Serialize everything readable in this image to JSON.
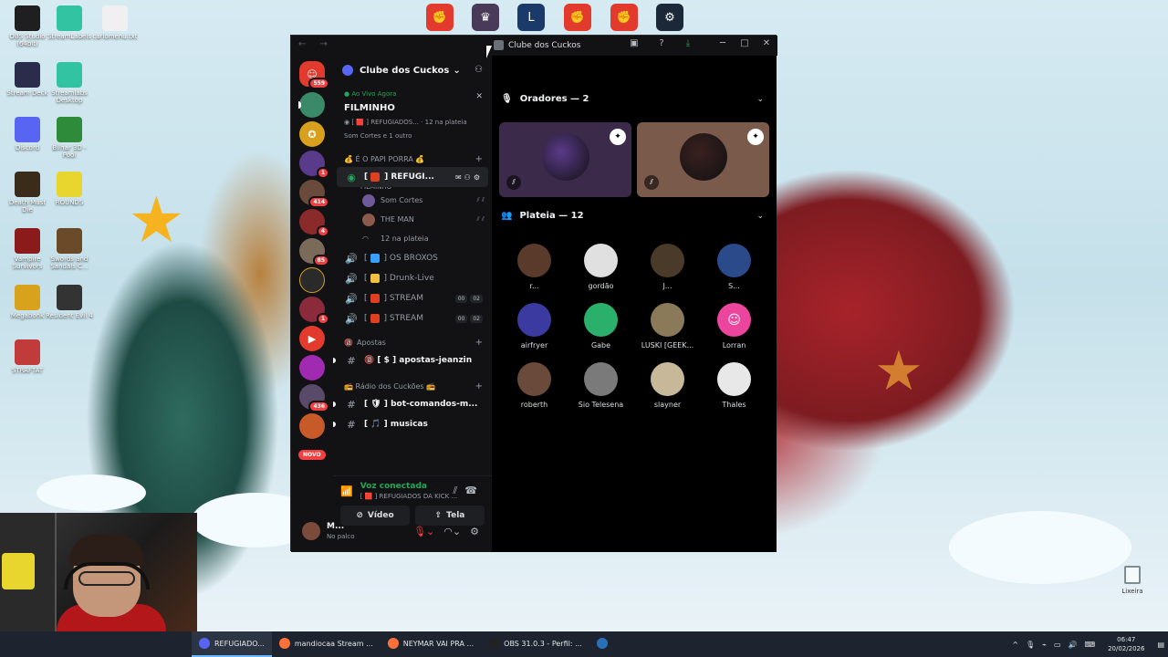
{
  "desktop": {
    "icons": [
      {
        "label": "OBS Studio (64bit)",
        "icon": "obs-icon",
        "color": "#1f1f1f"
      },
      {
        "label": "StreamLabels",
        "icon": "streamlabels-icon",
        "color": "#31c3a2"
      },
      {
        "label": "carlomenu.txt",
        "icon": "text-file-icon",
        "color": "#f0f0f0"
      },
      {
        "label": "Stream Deck",
        "icon": "stream-deck-icon",
        "color": "#2b2b4b"
      },
      {
        "label": "Streamlabs Desktop",
        "icon": "streamlabs-icon",
        "color": "#31c3a2"
      },
      {
        "label": "Discord",
        "icon": "discord-icon",
        "color": "#5865f2"
      },
      {
        "label": "Bilhar 3D - Pool",
        "icon": "pool-icon",
        "color": "#2d8b3a"
      },
      {
        "label": "Death Must Die",
        "icon": "death-must-die-icon",
        "color": "#3b2b1b"
      },
      {
        "label": "ROUNDS",
        "icon": "rounds-icon",
        "color": "#e8d52e"
      },
      {
        "label": "Vampire Survivors",
        "icon": "vampire-survivors-icon",
        "color": "#8b1a1a"
      },
      {
        "label": "Swords and Sandals C...",
        "icon": "swords-sandals-icon",
        "color": "#6b4a2a"
      },
      {
        "label": "Megabonk",
        "icon": "megabonk-icon",
        "color": "#d9a21c"
      },
      {
        "label": "Resident Evil 4",
        "icon": "resident-evil-icon",
        "color": "#333333"
      },
      {
        "label": "STRAFTAT",
        "icon": "straftat-icon",
        "color": "#c23b3b"
      }
    ],
    "recycle_bin": "Lixeira"
  },
  "webcam": {
    "label": "webcam overlay"
  },
  "discord": {
    "window_title": "Clube dos Cuckos",
    "nav_glyphs": "← →",
    "server_name": "Clube dos Cuckos",
    "guild_badges": [
      "559",
      "1",
      "414",
      "4",
      "85",
      "1",
      "436"
    ],
    "guild_new": "NOVO",
    "live": {
      "tag": "Ao Vivo Agora",
      "title": "FILMINHO",
      "channel_line": "[ 🟥 ] REFUGIADOS...",
      "audience_line": "12 na plateia",
      "members_line": "Som Cortes e 1 outro"
    },
    "categories": {
      "papi": "💰 É O PAPI PORRA 💰",
      "apostas": "Apostas",
      "radio": "📻 Rádio dos Cuckões 📻"
    },
    "stage_channel": {
      "name": "REFUGI...",
      "sub": "FILMINHO"
    },
    "stage_members": [
      {
        "name": "Som Cortes",
        "color": "#6e5a9a"
      },
      {
        "name": "THE MAN",
        "color": "#8a5a4a"
      }
    ],
    "stage_audience": "12 na plateia",
    "voice_channels": [
      {
        "name": "OS BROXOS",
        "emoji_color": "#3aa0ff",
        "tags": []
      },
      {
        "name": "Drunk-Live",
        "emoji_color": "#f0c040",
        "tags": []
      },
      {
        "name": "STREAM",
        "emoji_color": "#e04020",
        "tags": [
          "00",
          "02"
        ]
      },
      {
        "name": "STREAM",
        "emoji_color": "#e04020",
        "tags": [
          "00",
          "02"
        ]
      }
    ],
    "text_channels": [
      {
        "name": "apostas-jeanzin",
        "prefix": "🔞 [ $ ]"
      },
      {
        "name": "bot-comandos-m...",
        "prefix": "[ 🛡 ]"
      },
      {
        "name": "musicas",
        "prefix": "[ 🎵 ]"
      }
    ],
    "voice_panel": {
      "status": "Voz conectada",
      "channel": "[ 🟥 ] REFUGIADOS DA KICK ...",
      "video_label": "Vídeo",
      "screen_label": "Tela"
    },
    "user": {
      "name": "M...",
      "status": "No palco"
    },
    "stage": {
      "speakers_header": "Oradores — 2",
      "audience_header": "Plateia — 12",
      "speakers": [
        {
          "color": "#3b2a4a",
          "avatar": "#5b3a8a"
        },
        {
          "color": "#7a5a4a",
          "avatar": "#3a2020"
        }
      ],
      "audience": [
        {
          "name": "r...",
          "color": "#5a3a2a",
          "glyph": ""
        },
        {
          "name": "gordão",
          "color": "#e0e0e0",
          "glyph": ""
        },
        {
          "name": "J...",
          "color": "#4a3a2a",
          "glyph": ""
        },
        {
          "name": "S...",
          "color": "#2a4a8a",
          "glyph": ""
        },
        {
          "name": "airfryer",
          "color": "#3a3aa0",
          "glyph": ""
        },
        {
          "name": "Gabe",
          "color": "#2ab06a",
          "glyph": ""
        },
        {
          "name": "LUSKI [GEEK...",
          "color": "#8a7a5a",
          "glyph": ""
        },
        {
          "name": "Lorran",
          "color": "#eb459e",
          "glyph": "☺"
        },
        {
          "name": "roberth",
          "color": "#6a4a3a",
          "glyph": ""
        },
        {
          "name": "Sio Telesena",
          "color": "#7a7a7a",
          "glyph": ""
        },
        {
          "name": "slayner",
          "color": "#c8b89a",
          "glyph": ""
        },
        {
          "name": "Thales",
          "color": "#e8e8e8",
          "glyph": ""
        }
      ]
    }
  },
  "taskbar": {
    "items": [
      {
        "label": "REFUGIADO...",
        "color": "#5865f2"
      },
      {
        "label": "mandiocaa Stream ...",
        "color": "#ff7139"
      },
      {
        "label": "NEYMAR VAI PRA ...",
        "color": "#ff7139"
      },
      {
        "label": "OBS 31.0.3 - Perfil: ...",
        "color": "#222222"
      },
      {
        "label": "",
        "color": "#2b6fb8"
      }
    ],
    "time": "06:47",
    "date": "20/02/2026"
  },
  "colors": {
    "accent": "#5865f2",
    "live": "#23a55a",
    "danger": "#f23f42"
  }
}
